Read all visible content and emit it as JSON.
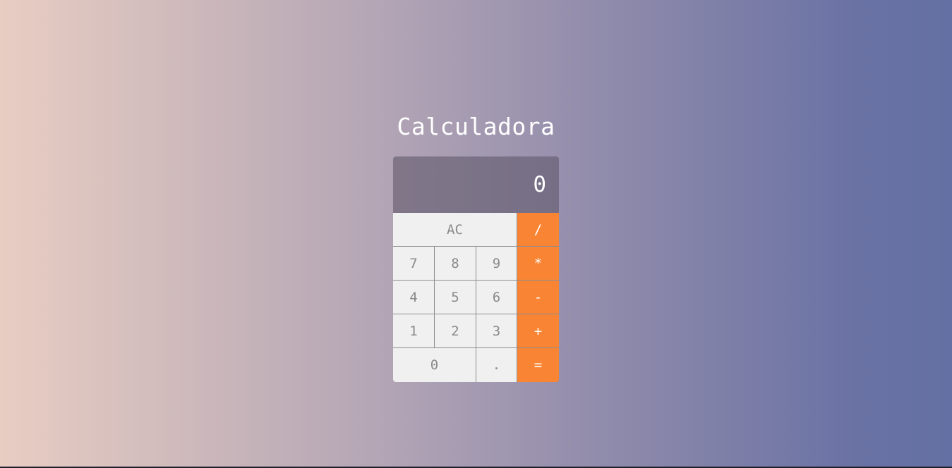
{
  "page": {
    "title": "Calculadora"
  },
  "display": {
    "value": "0"
  },
  "keys": {
    "clear": "AC",
    "divide": "/",
    "seven": "7",
    "eight": "8",
    "nine": "9",
    "multiply": "*",
    "four": "4",
    "five": "5",
    "six": "6",
    "subtract": "-",
    "one": "1",
    "two": "2",
    "three": "3",
    "add": "+",
    "zero": "0",
    "decimal": ".",
    "equals": "="
  },
  "colors": {
    "operator": "#f98534",
    "key_background": "#f0f0f0",
    "key_text": "#8a8a8a",
    "gradient_start": "#e8cdc2",
    "gradient_end": "#6470a3"
  }
}
